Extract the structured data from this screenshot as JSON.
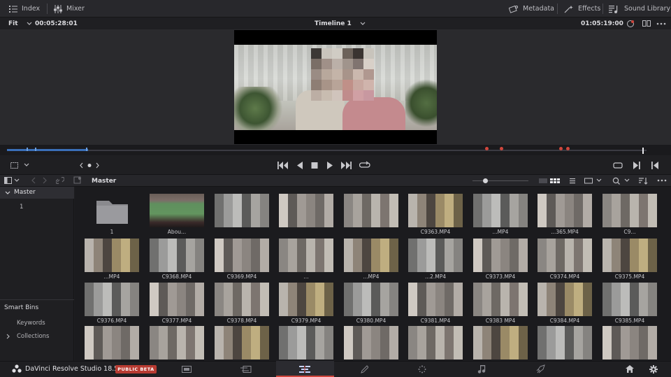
{
  "toolbar": {
    "index_label": "Index",
    "mixer_label": "Mixer",
    "metadata_label": "Metadata",
    "effects_label": "Effects",
    "sound_library_label": "Sound Library"
  },
  "viewer": {
    "zoom": "Fit",
    "source_timecode": "00:05:28:01",
    "timeline_name": "Timeline 1",
    "record_timecode": "01:05:19:00"
  },
  "media_pool": {
    "bin_title": "Master",
    "tree_master": "Master",
    "tree_child": "1",
    "smart_bins": "Smart Bins",
    "keywords": "Keywords",
    "collections": "Collections"
  },
  "clips": [
    {
      "label": "1",
      "kind": "folder"
    },
    {
      "label": "Abou...",
      "kind": "image"
    },
    {
      "label": "",
      "kind": "video"
    },
    {
      "label": "",
      "kind": "video"
    },
    {
      "label": "",
      "kind": "video"
    },
    {
      "label": "C9363.MP4",
      "kind": "video"
    },
    {
      "label": "...MP4",
      "kind": "video"
    },
    {
      "label": "...365.MP4",
      "kind": "video"
    },
    {
      "label": "C9...",
      "kind": "video"
    },
    {
      "label": "...MP4",
      "kind": "video"
    },
    {
      "label": "C9368.MP4",
      "kind": "video"
    },
    {
      "label": "C9369.MP4",
      "kind": "video"
    },
    {
      "label": "...",
      "kind": "video"
    },
    {
      "label": "...MP4",
      "kind": "video"
    },
    {
      "label": "...2.MP4",
      "kind": "video"
    },
    {
      "label": "C9373.MP4",
      "kind": "video"
    },
    {
      "label": "C9374.MP4",
      "kind": "video"
    },
    {
      "label": "C9375.MP4",
      "kind": "video"
    },
    {
      "label": "C9376.MP4",
      "kind": "video"
    },
    {
      "label": "C9377.MP4",
      "kind": "video"
    },
    {
      "label": "C9378.MP4",
      "kind": "video"
    },
    {
      "label": "C9379.MP4",
      "kind": "video"
    },
    {
      "label": "C9380.MP4",
      "kind": "video"
    },
    {
      "label": "C9381.MP4",
      "kind": "video"
    },
    {
      "label": "C9383 MP4",
      "kind": "video"
    },
    {
      "label": "C9384.MP4",
      "kind": "video"
    },
    {
      "label": "C9385.MP4",
      "kind": "video"
    },
    {
      "label": "",
      "kind": "video"
    },
    {
      "label": "",
      "kind": "video"
    },
    {
      "label": "",
      "kind": "video"
    },
    {
      "label": "",
      "kind": "video"
    },
    {
      "label": "",
      "kind": "video"
    },
    {
      "label": "",
      "kind": "video"
    },
    {
      "label": "",
      "kind": "video"
    },
    {
      "label": "",
      "kind": "video"
    },
    {
      "label": "",
      "kind": "video"
    }
  ],
  "footer": {
    "app_name": "DaVinci Resolve Studio 18.5",
    "beta_badge": "PUBLIC BETA"
  },
  "colors": {
    "accent_red": "#d0463c",
    "playhead_blue": "#3a6fb8"
  }
}
